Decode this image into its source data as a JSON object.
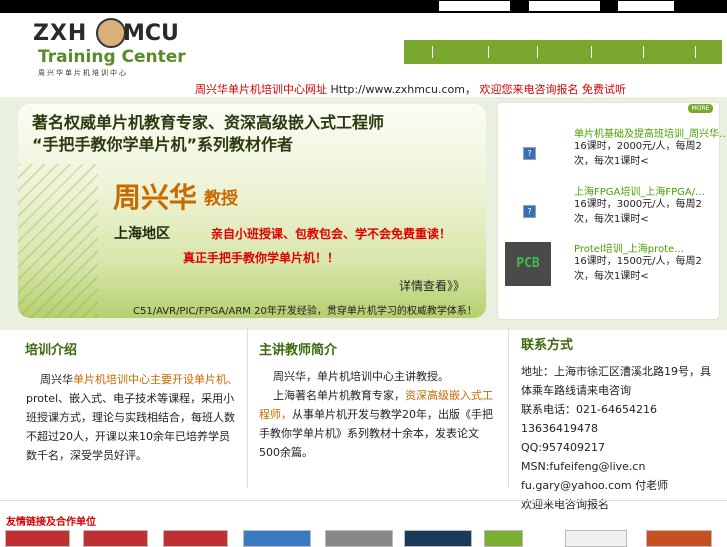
{
  "logo": {
    "brand_left": "ZXH",
    "brand_right": "MCU",
    "subtitle": "Training Center",
    "chinese_name": "周兴华单片机培训中心"
  },
  "headline": {
    "prefix": "周兴华单片机培训中心网址",
    "url": "Http://www.zxhmcu.com，",
    "suffix1": "欢迎您来电咨询报名",
    "suffix2": "免费试听"
  },
  "banner": {
    "line1": "著名权威单片机教育专家、资深高级嵌入式工程师",
    "line2": "“手把手教你学单片机”系列教材作者",
    "name": "周兴华",
    "title": "教授",
    "area": "上海地区",
    "perk1": "亲自小班授课、包教包会、学不会免费重读！",
    "perk2": "真正手把手教你学单片机！！",
    "more": "详情查看》》",
    "footer": "C51/AVR/PIC/FPGA/ARM 20年开发经验，贯穿单片机学习的权威教学体系！"
  },
  "courses_panel": {
    "more_label": "MORE",
    "items": [
      {
        "title": "单片机基础及提高班培训_周兴华…",
        "desc": "16课时，2000元/人，每周2次，每次1课时<",
        "icon": "broken-image-icon",
        "icon_glyph": "?"
      },
      {
        "title": "上海FPGA培训_上海FPGA/…",
        "desc": "16课时，3000元/人，每周2次，每次1课时<",
        "icon": "broken-image-icon",
        "icon_glyph": "?"
      },
      {
        "title": "Protel培训_上海prote…",
        "desc": "16课时，1500元/人，每周2次，每次1课时<",
        "icon": "pcb-thumbnail-icon",
        "icon_glyph": "PCB"
      }
    ]
  },
  "sections": {
    "intro": {
      "title": "培训介绍",
      "text_before": "周兴华",
      "text_highlight": "单片机培训中心主要开设单片机、",
      "text_after": "protel、嵌入式、电子技术等课程，采用小班授课方式，理论与实践相结合，每班人数不超过20人，开课以来10余年已培养学员数千名，深受学员好评。"
    },
    "teacher": {
      "title": "主讲教师简介",
      "para1": "周兴华，单片机培训中心主讲教授。",
      "para2_a": "上海著名单片机教育专家，",
      "para2_hl": "资深高级嵌入式工程师，",
      "para2_b": "从事单片机开发与教学20年，出版《手把手教你学单片机》系列教材十余本，发表论文500余篇。"
    },
    "contact": {
      "title": "联系方式",
      "address": "地址：上海市徐汇区漕溪北路19号，具体乘车路线请来电咨询",
      "phone": "联系电话：021-64654216",
      "mobile": "13636419478",
      "qq": "QQ:957409217",
      "msn": "MSN:fufeifeng@live.cn",
      "email_line": "fu.gary@yahoo.com 付老师",
      "note": "欢迎来电咨询报名"
    }
  },
  "partners": {
    "title": "友情链接及合作单位"
  },
  "colors": {
    "accent_green": "#7aa82f",
    "link_green": "#4aa000",
    "red": "#d40000",
    "orange": "#c86a00"
  }
}
